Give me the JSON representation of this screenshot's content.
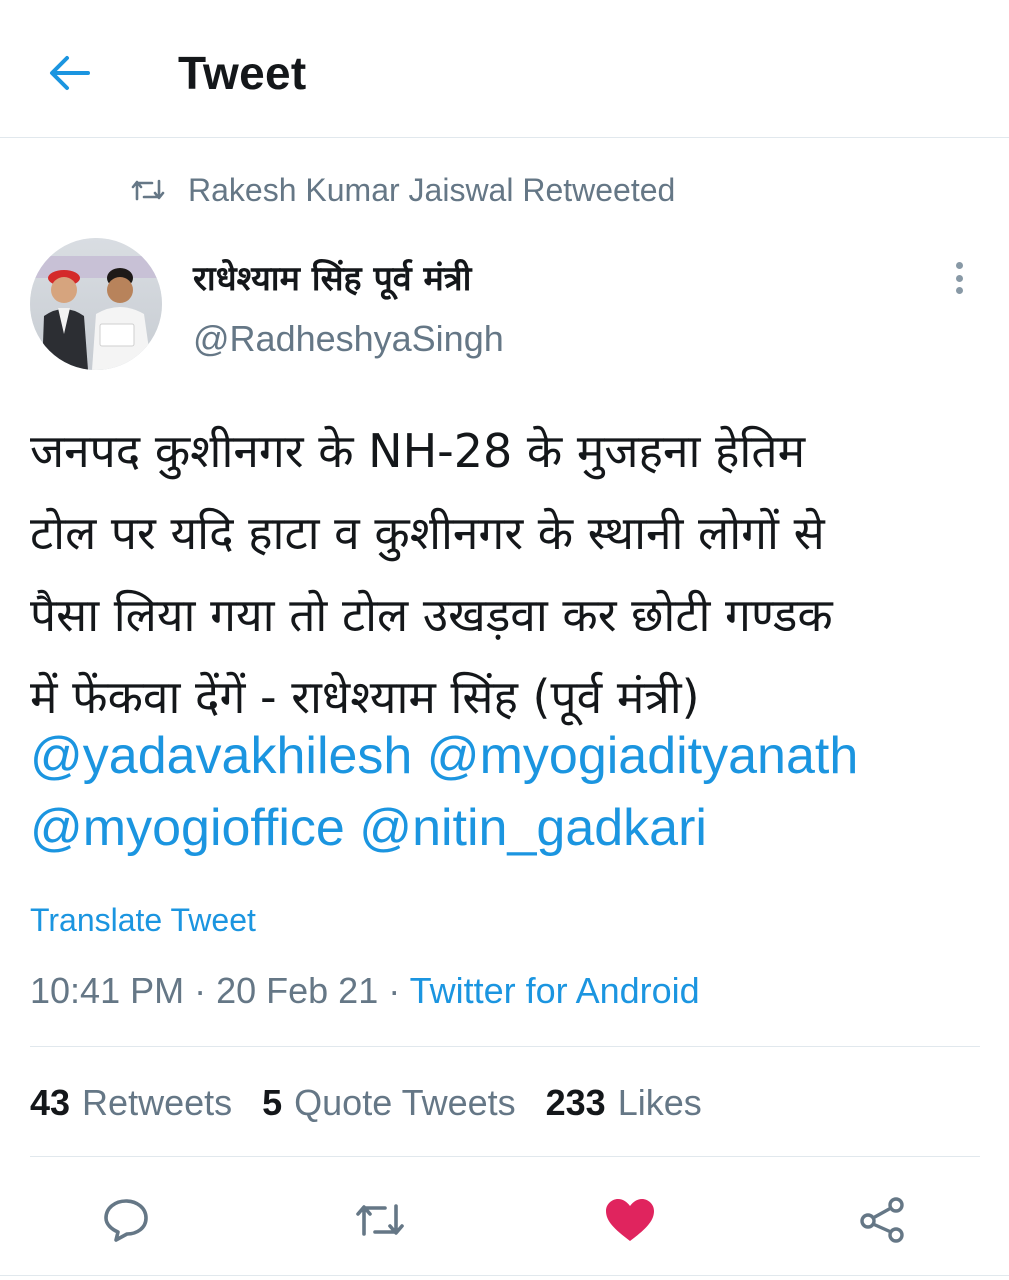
{
  "header": {
    "title": "Tweet",
    "back_icon": "arrow-left-icon"
  },
  "retweet": {
    "text": "Rakesh Kumar Jaiswal Retweeted",
    "icon": "retweet-icon"
  },
  "author": {
    "name": "राधेश्याम सिंह पूर्व मंत्री",
    "handle": "@RadheshyaSingh"
  },
  "tweet": {
    "lines": [
      "जनपद कुशीनगर के NH-28 के मुजहना हेतिम",
      "टोल पर यदि हाटा व कुशीनगर के स्थानी लोगों से",
      "पैसा लिया गया तो टोल उखड़वा कर छोटी गण्डक",
      "में फेंकवा देंगें - राधेश्याम सिंह (पूर्व मंत्री)"
    ],
    "mentions": [
      "@yadavakhilesh",
      "@myogiadityanath",
      "@myogioffice",
      "@nitin_gadkari"
    ]
  },
  "translate_label": "Translate Tweet",
  "meta": {
    "time": "10:41 PM",
    "sep1": " · ",
    "date": "20 Feb 21",
    "sep2": " · ",
    "source": "Twitter for Android"
  },
  "stats": {
    "retweets_count": "43",
    "retweets_label": "Retweets",
    "quotes_count": "5",
    "quotes_label": "Quote Tweets",
    "likes_count": "233",
    "likes_label": "Likes"
  },
  "colors": {
    "accent": "#1b95e0",
    "like": "#e0245e",
    "muted": "#657786",
    "text": "#14171a"
  }
}
